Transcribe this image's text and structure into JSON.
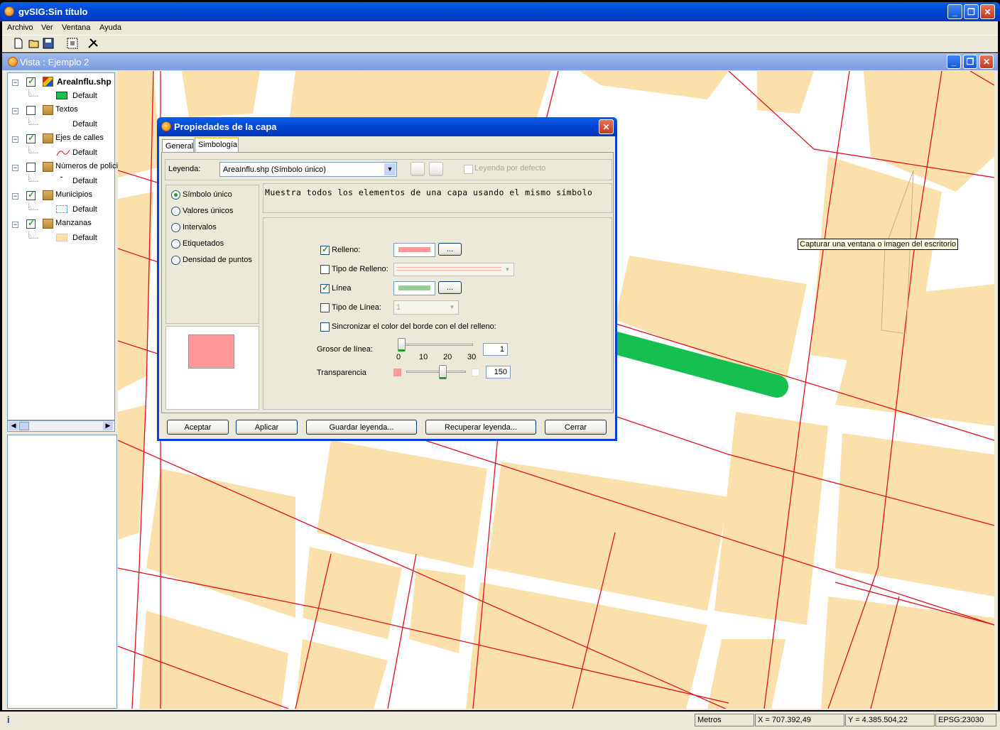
{
  "app": {
    "title": "gvSIG:Sin título"
  },
  "menu": [
    "Archivo",
    "Ver",
    "Ventana",
    "Ayuda"
  ],
  "toolbar": {
    "icons": [
      "new-document-icon",
      "open-folder-icon",
      "save-icon",
      "capture-icon",
      "tools-icon"
    ]
  },
  "view": {
    "title": "Vista : Ejemplo 2"
  },
  "layers": [
    {
      "name": "AreaInflu.shp",
      "checked": true,
      "legend": "Default",
      "bold": true
    },
    {
      "name": "Textos",
      "checked": false,
      "legend": "Default"
    },
    {
      "name": "Ejes de calles",
      "checked": true,
      "legend": "Default"
    },
    {
      "name": "Números de polici",
      "checked": false,
      "legend": "Default"
    },
    {
      "name": "Municipios",
      "checked": true,
      "legend": "Default"
    },
    {
      "name": "Manzanas",
      "checked": true,
      "legend": "Default"
    }
  ],
  "tooltip": "Capturar una ventana o imagen del escritorio",
  "dialog": {
    "title": "Propiedades de la capa",
    "tabs": [
      "General",
      "Simbología"
    ],
    "legend_label": "Leyenda:",
    "legend_value": "AreaInflu.shp (Símbolo único)",
    "default_legend": "Leyenda por defecto",
    "legend_types": [
      "Símbolo único",
      "Valores únicos",
      "Intervalos",
      "Etiquetados",
      "Densidad de puntos"
    ],
    "description": "Muestra todos los elementos de una capa usando el mismo símbolo",
    "fill_label": "Relleno:",
    "fill_type_label": "Tipo de Relleno:",
    "line_label": "Línea",
    "line_type_label": "Tipo de Línea:",
    "line_type_value": "1",
    "sync_label": "Sincronizar el color del borde con el del relleno:",
    "width_label": "Grosor de línea:",
    "width_ticks": [
      "0",
      "10",
      "20",
      "30"
    ],
    "width_value": "1",
    "transparency_label": "Transparencia",
    "transparency_value": "150",
    "browse": "...",
    "buttons": [
      "Aceptar",
      "Aplicar",
      "Guardar leyenda...",
      "Recuperar leyenda...",
      "Cerrar"
    ],
    "fill_color": "#ff9999",
    "line_color": "#99cc99"
  },
  "status": {
    "info": "i",
    "units": "Metros",
    "x": "X = 707.392,49",
    "y": "Y = 4.385.504,22",
    "epsg": "EPSG:23030"
  }
}
